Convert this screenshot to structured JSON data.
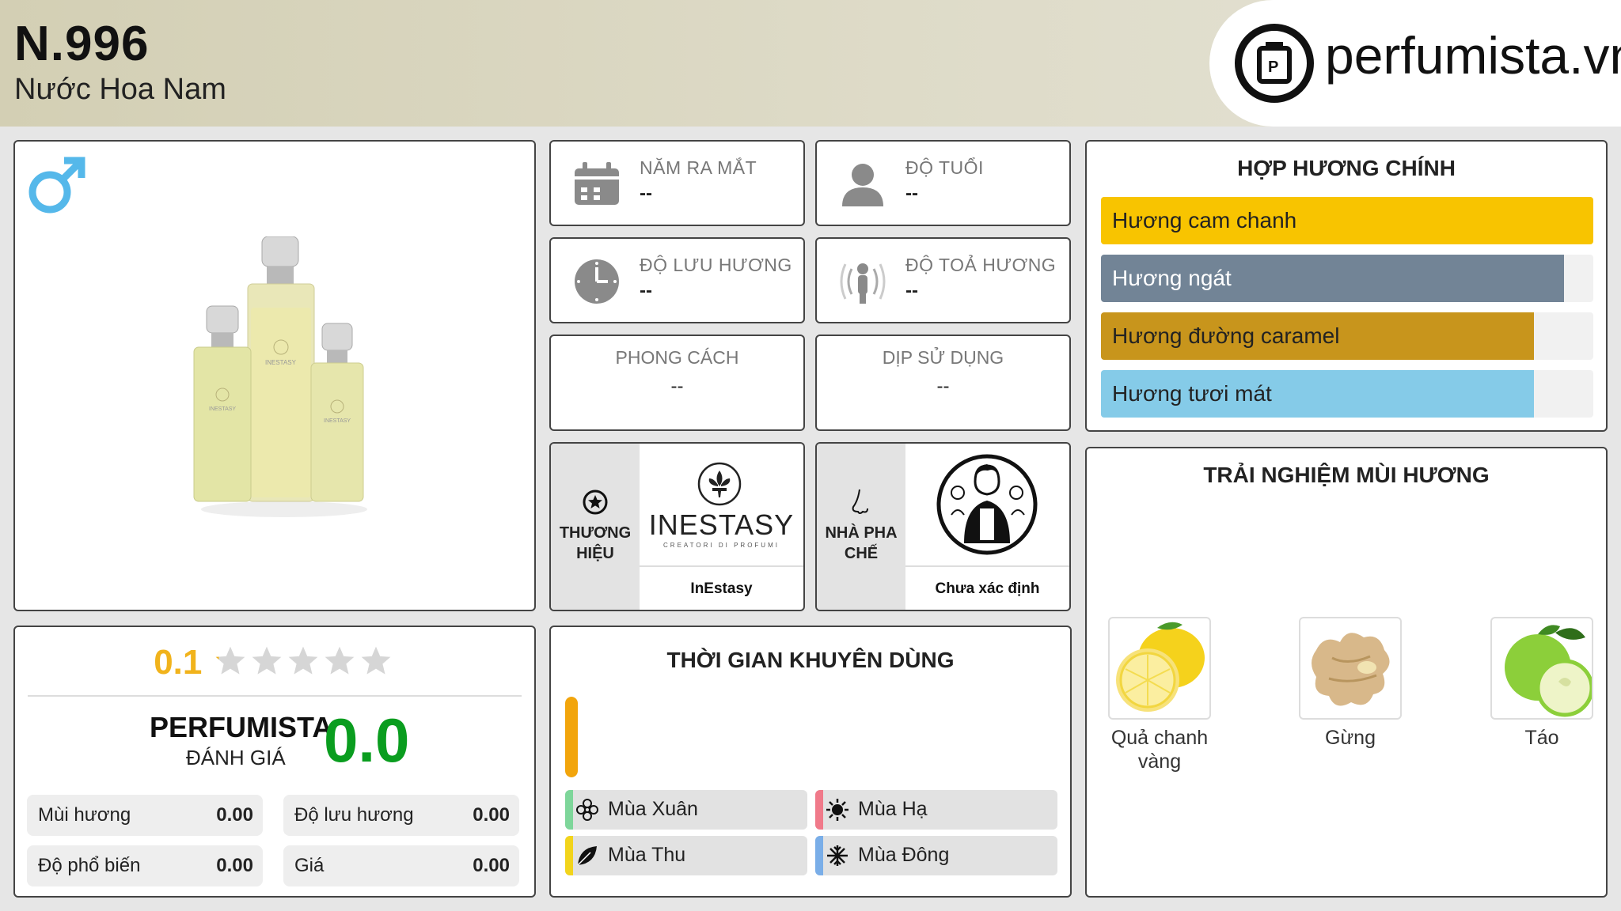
{
  "header": {
    "title": "N.996",
    "subtitle": "Nước Hoa Nam",
    "logo_text": "perfumista.vn"
  },
  "product": {
    "gender_icon": "male-symbol-icon",
    "bottle_labels": [
      "INESTASY",
      "INESTASY",
      "INESTASY"
    ]
  },
  "info": {
    "release_year": {
      "label": "NĂM RA MẮT",
      "value": "--",
      "icon": "calendar-icon"
    },
    "age": {
      "label": "ĐỘ TUỔI",
      "value": "--",
      "icon": "person-icon"
    },
    "longevity": {
      "label": "ĐỘ LƯU HƯƠNG",
      "value": "--",
      "icon": "clock-icon"
    },
    "sillage": {
      "label": "ĐỘ TOẢ HƯƠNG",
      "value": "--",
      "icon": "radiate-icon"
    },
    "style": {
      "label": "PHONG CÁCH",
      "value": "--"
    },
    "occasion": {
      "label": "DỊP SỬ DỤNG",
      "value": "--"
    }
  },
  "brand": {
    "side_label": "THƯƠNG HIỆU",
    "logo_name": "INESTASY",
    "logo_tagline": "CREATORI DI PROFUMI",
    "name": "InEstasy"
  },
  "perfumer": {
    "side_label": "NHÀ PHA CHẾ",
    "name": "Chưa xác định"
  },
  "accords": {
    "title": "HỢP HƯƠNG CHÍNH",
    "items": [
      {
        "label": "Hương cam chanh",
        "pct": 100,
        "color": "#f8c400"
      },
      {
        "label": "Hương ngát",
        "pct": 94,
        "color": "#728496"
      },
      {
        "label": "Hương đường caramel",
        "pct": 88,
        "color": "#c8951c"
      },
      {
        "label": "Hương tươi mát",
        "pct": 88,
        "color": "#85cbe8"
      }
    ]
  },
  "experience": {
    "title": "TRẢI NGHIỆM MÙI HƯƠNG",
    "notes": [
      {
        "name": "Quả chanh vàng",
        "icon": "lemon-icon"
      },
      {
        "name": "Gừng",
        "icon": "ginger-icon"
      },
      {
        "name": "Táo",
        "icon": "apple-icon"
      }
    ]
  },
  "rating": {
    "user_score": "0.1",
    "stars_filled": 0.1,
    "brand_label": "PERFUMISTA",
    "brand_sub": "ĐÁNH GIÁ",
    "score": "0.0",
    "metrics": [
      {
        "label": "Mùi hương",
        "value": "0.00"
      },
      {
        "label": "Độ lưu hương",
        "value": "0.00"
      },
      {
        "label": "Độ phổ biến",
        "value": "0.00"
      },
      {
        "label": "Giá",
        "value": "0.00"
      }
    ]
  },
  "recommend": {
    "title": "THỜI GIAN KHUYÊN DÙNG",
    "day_night_level": 1.0,
    "seasons": [
      {
        "name": "Mùa Xuân",
        "color": "#7ed69a",
        "icon": "flower-icon"
      },
      {
        "name": "Mùa Hạ",
        "color": "#f07a8a",
        "icon": "sun-icon"
      },
      {
        "name": "Mùa Thu",
        "color": "#f2d41c",
        "icon": "leaf-icon"
      },
      {
        "name": "Mùa Đông",
        "color": "#7aaee8",
        "icon": "snowflake-icon"
      }
    ]
  }
}
